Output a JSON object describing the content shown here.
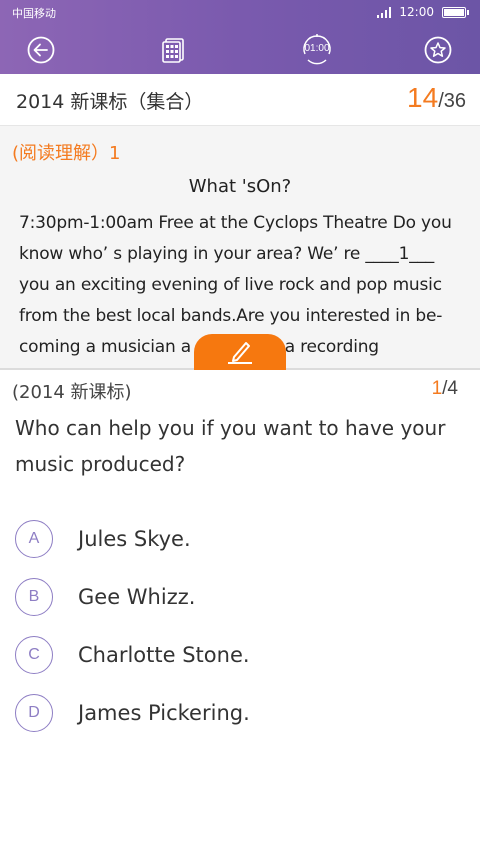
{
  "status_bar": {
    "carrier": "中国移动",
    "time": "12:00"
  },
  "toolbar": {
    "timer": "01:00",
    "icons": [
      "back-arrow-icon",
      "answer-sheet-icon",
      "timer-icon",
      "favorite-star-icon"
    ]
  },
  "header": {
    "paper_title": "2014 新课标（集合）",
    "progress_current": "14",
    "progress_total": "/36"
  },
  "passage": {
    "section_label": "(阅读理解）1",
    "title": "What 'sOn?",
    "lines": [
      "7:30pm-1:00am Free at the Cyclops Theatre Do you",
      "know who’ s playing in your area? We’  re ____1___",
      "you an exciting evening of live rock and pop music",
      "from the best local bands.Are you interested in be-",
      "coming a musician a                  a recording"
    ]
  },
  "question": {
    "source": "(2014 新课标)",
    "counter_current": "1",
    "counter_total": "/4",
    "text": "Who can help you if you want to have your music produced?",
    "options": [
      {
        "letter": "A",
        "text": "Jules Skye."
      },
      {
        "letter": "B",
        "text": "Gee Whizz."
      },
      {
        "letter": "C",
        "text": "Charlotte Stone."
      },
      {
        "letter": "D",
        "text": "James Pickering."
      }
    ]
  },
  "colors": {
    "header": "#7a5aae",
    "accent": "#f47b20",
    "option": "#8e7ec4"
  }
}
